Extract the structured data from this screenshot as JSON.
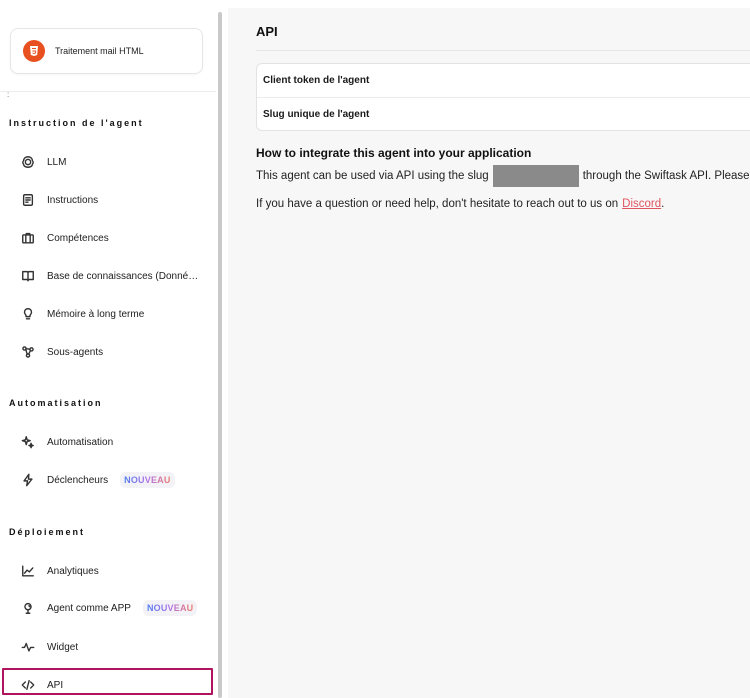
{
  "agent": {
    "name": "Traitement mail HTML",
    "icon": "html5-icon"
  },
  "sidebar": {
    "sections": [
      {
        "title": "Instruction de l'agent",
        "items": [
          {
            "label": "LLM",
            "icon": "brain-icon"
          },
          {
            "label": "Instructions",
            "icon": "document-icon"
          },
          {
            "label": "Compétences",
            "icon": "briefcase-icon"
          },
          {
            "label": "Base de connaissances (Donné…",
            "icon": "book-icon"
          },
          {
            "label": "Mémoire à long terme",
            "icon": "lightbulb-icon"
          },
          {
            "label": "Sous-agents",
            "icon": "network-icon"
          }
        ]
      },
      {
        "title": "Automatisation",
        "items": [
          {
            "label": "Automatisation",
            "icon": "sparkle-icon"
          },
          {
            "label": "Déclencheurs",
            "icon": "lightning-icon",
            "badge": "NOUVEAU"
          }
        ]
      },
      {
        "title": "Déploiement",
        "items": [
          {
            "label": "Analytiques",
            "icon": "chart-icon"
          },
          {
            "label": "Agent comme APP",
            "icon": "agent-icon",
            "badge": "NOUVEAU"
          },
          {
            "label": "Widget",
            "icon": "pulse-icon"
          },
          {
            "label": "API",
            "icon": "code-icon",
            "active": true
          }
        ]
      }
    ]
  },
  "main": {
    "title": "API",
    "fields": [
      {
        "label": "Client token de l'agent"
      },
      {
        "label": "Slug unique de l'agent"
      }
    ],
    "integration": {
      "heading": "How to integrate this agent into your application",
      "line1_before": "This agent can be used via API using the slug",
      "line1_after": "through the Swiftask API. Please g",
      "line2_before": "If you have a question or need help, don't hesitate to reach out to us on",
      "line2_link": "Discord",
      "line2_after": "."
    }
  },
  "colors": {
    "accent_active": "#b0145f",
    "link": "#e0555f",
    "html_logo": "#e8501f"
  }
}
